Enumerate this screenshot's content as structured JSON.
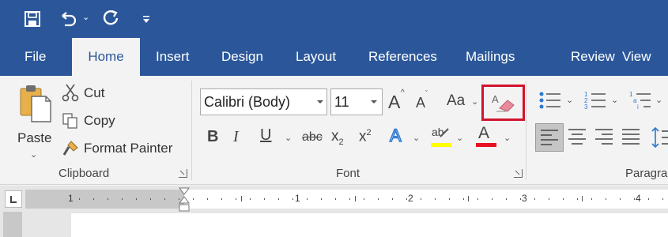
{
  "quick_access": {
    "save_icon": "save-icon",
    "undo_icon": "undo-icon",
    "redo_icon": "redo-icon",
    "customize_icon": "customize-toolbar-icon"
  },
  "tabs": [
    {
      "label": "File",
      "active": false
    },
    {
      "label": "Home",
      "active": true
    },
    {
      "label": "Insert",
      "active": false
    },
    {
      "label": "Design",
      "active": false
    },
    {
      "label": "Layout",
      "active": false
    },
    {
      "label": "References",
      "active": false
    },
    {
      "label": "Mailings",
      "active": false
    },
    {
      "label": "Review",
      "active": false
    },
    {
      "label": "View",
      "active": false
    }
  ],
  "clipboard": {
    "paste_label": "Paste",
    "cut_label": "Cut",
    "copy_label": "Copy",
    "format_painter_label": "Format Painter",
    "group_label": "Clipboard"
  },
  "font": {
    "font_name": "Calibri (Body)",
    "font_size": "11",
    "change_case_label": "Aa",
    "group_label": "Font",
    "clear_formatting_highlight_color": "#d0142c"
  },
  "paragraph": {
    "group_label": "Paragra"
  },
  "ruler": {
    "numbers": [
      "1",
      "1",
      "2",
      "3",
      "4"
    ]
  },
  "colors": {
    "accent": "#2b579a",
    "highlight": "#ffff00",
    "font_color": "#e81123"
  }
}
